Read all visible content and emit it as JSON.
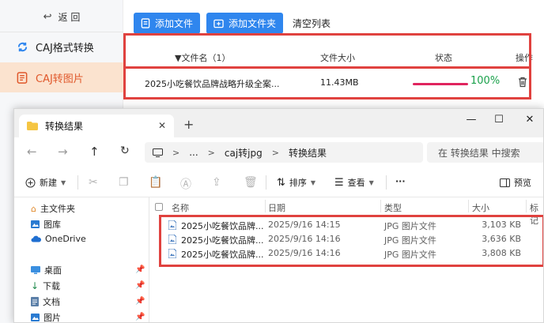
{
  "app": {
    "back_label": "返 回",
    "sidebar": [
      {
        "label": "CAJ格式转换"
      },
      {
        "label": "CAJ转图片"
      }
    ],
    "toolbar": {
      "add_file": "添加文件",
      "add_folder": "添加文件夹",
      "clear_list": "清空列表"
    },
    "table": {
      "headers": {
        "name": "▼文件名（1）",
        "size": "文件大小",
        "status": "状态",
        "action": "操作"
      },
      "rows": [
        {
          "name": "2025小吃餐饮品牌战略升级全案...",
          "size": "11.43MB",
          "progress": 100,
          "progress_text": "100%"
        }
      ]
    },
    "colors": {
      "accent": "#2f86ee",
      "active": "#e0582b",
      "highlight": "#e0423f",
      "progress": "#e0245e",
      "success": "#1aa14b"
    }
  },
  "explorer": {
    "tab_title": "转换结果",
    "breadcrumb": [
      "...",
      "caj转jpg",
      "转换结果"
    ],
    "search_placeholder": "在 转换结果 中搜索",
    "commands": {
      "new": "新建",
      "sort": "排序",
      "view": "查看",
      "more": "···",
      "preview": "预览"
    },
    "nav": [
      {
        "label": "主文件夹",
        "icon": "home-icon"
      },
      {
        "label": "图库",
        "icon": "gallery-icon"
      },
      {
        "label": "OneDrive",
        "icon": "cloud-icon"
      },
      {
        "label": "桌面",
        "icon": "desktop-icon"
      },
      {
        "label": "下载",
        "icon": "download-icon"
      },
      {
        "label": "文档",
        "icon": "document-icon"
      },
      {
        "label": "图片",
        "icon": "pictures-icon"
      }
    ],
    "columns": {
      "name": "名称",
      "date": "日期",
      "type": "类型",
      "size": "大小",
      "tags": "标记"
    },
    "files": [
      {
        "name": "2025小吃餐饮品牌...",
        "date": "2025/9/16 14:15",
        "type": "JPG 图片文件",
        "size": "3,103 KB"
      },
      {
        "name": "2025小吃餐饮品牌...",
        "date": "2025/9/16 14:16",
        "type": "JPG 图片文件",
        "size": "3,636 KB"
      },
      {
        "name": "2025小吃餐饮品牌...",
        "date": "2025/9/16 14:16",
        "type": "JPG 图片文件",
        "size": "3,808 KB"
      }
    ]
  }
}
